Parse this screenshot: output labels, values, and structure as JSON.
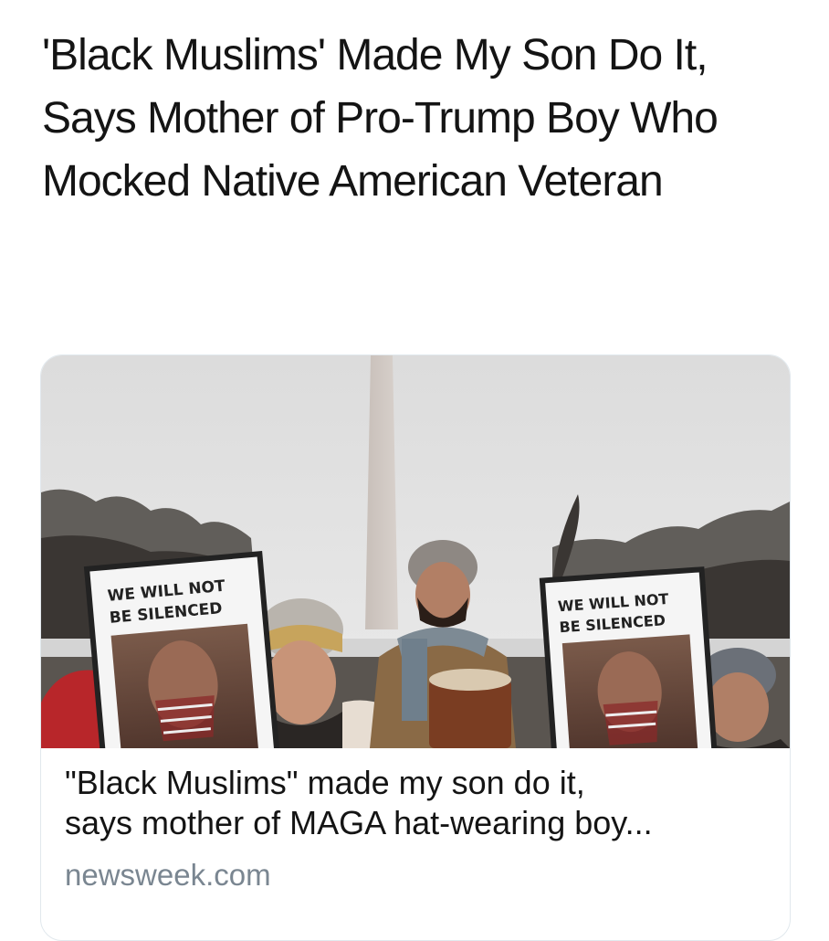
{
  "tweet": {
    "text": "'Black Muslims' Made My Son Do It, Says Mother of Pro-Trump Boy Who Mocked Native American Veteran"
  },
  "link_card": {
    "title_line1": "\"Black Muslims\" made my son do it,",
    "title_line2": "says mother of MAGA hat-wearing boy...",
    "domain": "newsweek.com",
    "image": {
      "sign_left_line1": "WE WILL NOT",
      "sign_left_line2": "BE SILENCED",
      "sign_right_line1": "WE WILL NOT",
      "sign_right_line2": "BE SILENCED"
    }
  },
  "colors": {
    "text": "#141414",
    "domain": "#7a8691",
    "card_border": "#e1e8ed",
    "sky": "#e3e3e3"
  }
}
